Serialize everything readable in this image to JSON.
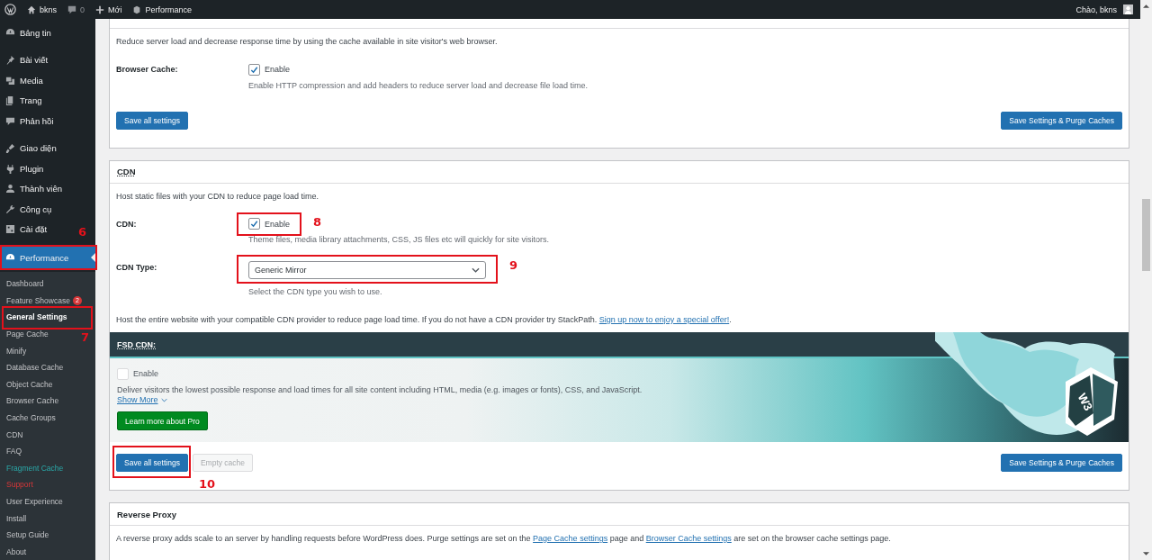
{
  "admin_bar": {
    "site": "bkns",
    "comments": "0",
    "new": "Mới",
    "plugin": "Performance",
    "greeting": "Chào, bkns"
  },
  "menu_groups": [
    [
      {
        "label": "Bảng tin",
        "selected": false
      }
    ],
    [
      {
        "label": "Bài viết",
        "selected": false
      },
      {
        "label": "Media",
        "selected": false
      },
      {
        "label": "Trang",
        "selected": false
      },
      {
        "label": "Phản hồi",
        "selected": false
      }
    ],
    [
      {
        "label": "Giao diện",
        "selected": false
      },
      {
        "label": "Plugin",
        "selected": false
      },
      {
        "label": "Thành viên",
        "selected": false
      },
      {
        "label": "Công cụ",
        "selected": false
      },
      {
        "label": "Cài đặt",
        "selected": false
      }
    ],
    [
      {
        "label": "Performance",
        "selected": true,
        "callout": "6"
      }
    ]
  ],
  "submenu": [
    {
      "label": "Dashboard",
      "selected": false,
      "kind": "normal"
    },
    {
      "label": "Feature Showcase",
      "selected": false,
      "kind": "normal",
      "badge": "2"
    },
    {
      "label": "General Settings",
      "selected": true,
      "kind": "normal",
      "callout": "7"
    },
    {
      "label": "Page Cache",
      "selected": false,
      "kind": "normal"
    },
    {
      "label": "Minify",
      "selected": false,
      "kind": "normal"
    },
    {
      "label": "Database Cache",
      "selected": false,
      "kind": "normal"
    },
    {
      "label": "Object Cache",
      "selected": false,
      "kind": "normal"
    },
    {
      "label": "Browser Cache",
      "selected": false,
      "kind": "normal"
    },
    {
      "label": "Cache Groups",
      "selected": false,
      "kind": "normal"
    },
    {
      "label": "CDN",
      "selected": false,
      "kind": "normal"
    },
    {
      "label": "FAQ",
      "selected": false,
      "kind": "normal"
    },
    {
      "label": "Fragment Cache",
      "selected": false,
      "kind": "accent"
    },
    {
      "label": "Support",
      "selected": false,
      "kind": "alert"
    },
    {
      "label": "User Experience",
      "selected": false,
      "kind": "normal"
    },
    {
      "label": "Install",
      "selected": false,
      "kind": "normal"
    },
    {
      "label": "Setup Guide",
      "selected": false,
      "kind": "normal"
    },
    {
      "label": "About",
      "selected": false,
      "kind": "normal"
    }
  ],
  "panels": [
    {
      "description": [
        {
          "kind": "text",
          "text": "Reduce server load and decrease response time by using the cache available in site visitor's web browser."
        }
      ],
      "fields": [
        {
          "kind": "checkbox",
          "label": "Browser Cache:",
          "checked": true,
          "option": "Enable",
          "hint": "Enable HTTP compression and add headers to reduce server load and decrease file load time."
        }
      ],
      "buttons": [
        {
          "label": "Save all settings",
          "disabled": false
        }
      ],
      "side_buttons": [
        {
          "label": "Save Settings & Purge Caches",
          "disabled": false
        }
      ]
    },
    {
      "title": "CDN",
      "description": [
        {
          "kind": "text",
          "text": "Host static files with your CDN to reduce page load time."
        }
      ],
      "fields": [
        {
          "kind": "checkbox",
          "label": "CDN:",
          "checked": true,
          "option": "Enable",
          "hint": "Theme files, media library attachments, CSS, JS files etc will quickly for site visitors.",
          "callout": "8"
        },
        {
          "kind": "select",
          "label": "CDN Type:",
          "value": "Generic Mirror",
          "hint": "Select the CDN type you wish to use.",
          "callout": "9"
        }
      ],
      "note": [
        {
          "kind": "text",
          "text": "Host the entire website with your compatible CDN provider to reduce page load time. If you do not have a CDN provider try StackPath. "
        },
        {
          "kind": "link",
          "text": "Sign up now to enjoy a special offer!"
        },
        {
          "kind": "text",
          "text": "."
        }
      ],
      "banner": {
        "title": "FSD CDN:",
        "checked": false,
        "option": "Enable",
        "description": "Deliver visitors the lowest possible response and load times for all site content including HTML, media (e.g. images or fonts), CSS, and JavaScript.",
        "show_more": "Show More",
        "button": "Learn more about Pro",
        "logo": "W3"
      },
      "buttons": [
        {
          "label": "Save all settings",
          "disabled": false,
          "callout": "10"
        },
        {
          "label": "Empty cache",
          "disabled": true
        }
      ],
      "side_buttons": [
        {
          "label": "Save Settings & Purge Caches",
          "disabled": false
        }
      ]
    },
    {
      "title": "Reverse Proxy",
      "description": [
        {
          "kind": "text",
          "text": "A reverse proxy adds scale to an server by handling requests before WordPress does. Purge settings are set on the "
        },
        {
          "kind": "link",
          "text": "Page Cache settings"
        },
        {
          "kind": "text",
          "text": " page and "
        },
        {
          "kind": "link",
          "text": "Browser Cache settings"
        },
        {
          "kind": "text",
          "text": " are set on the browser cache settings page."
        }
      ]
    }
  ]
}
